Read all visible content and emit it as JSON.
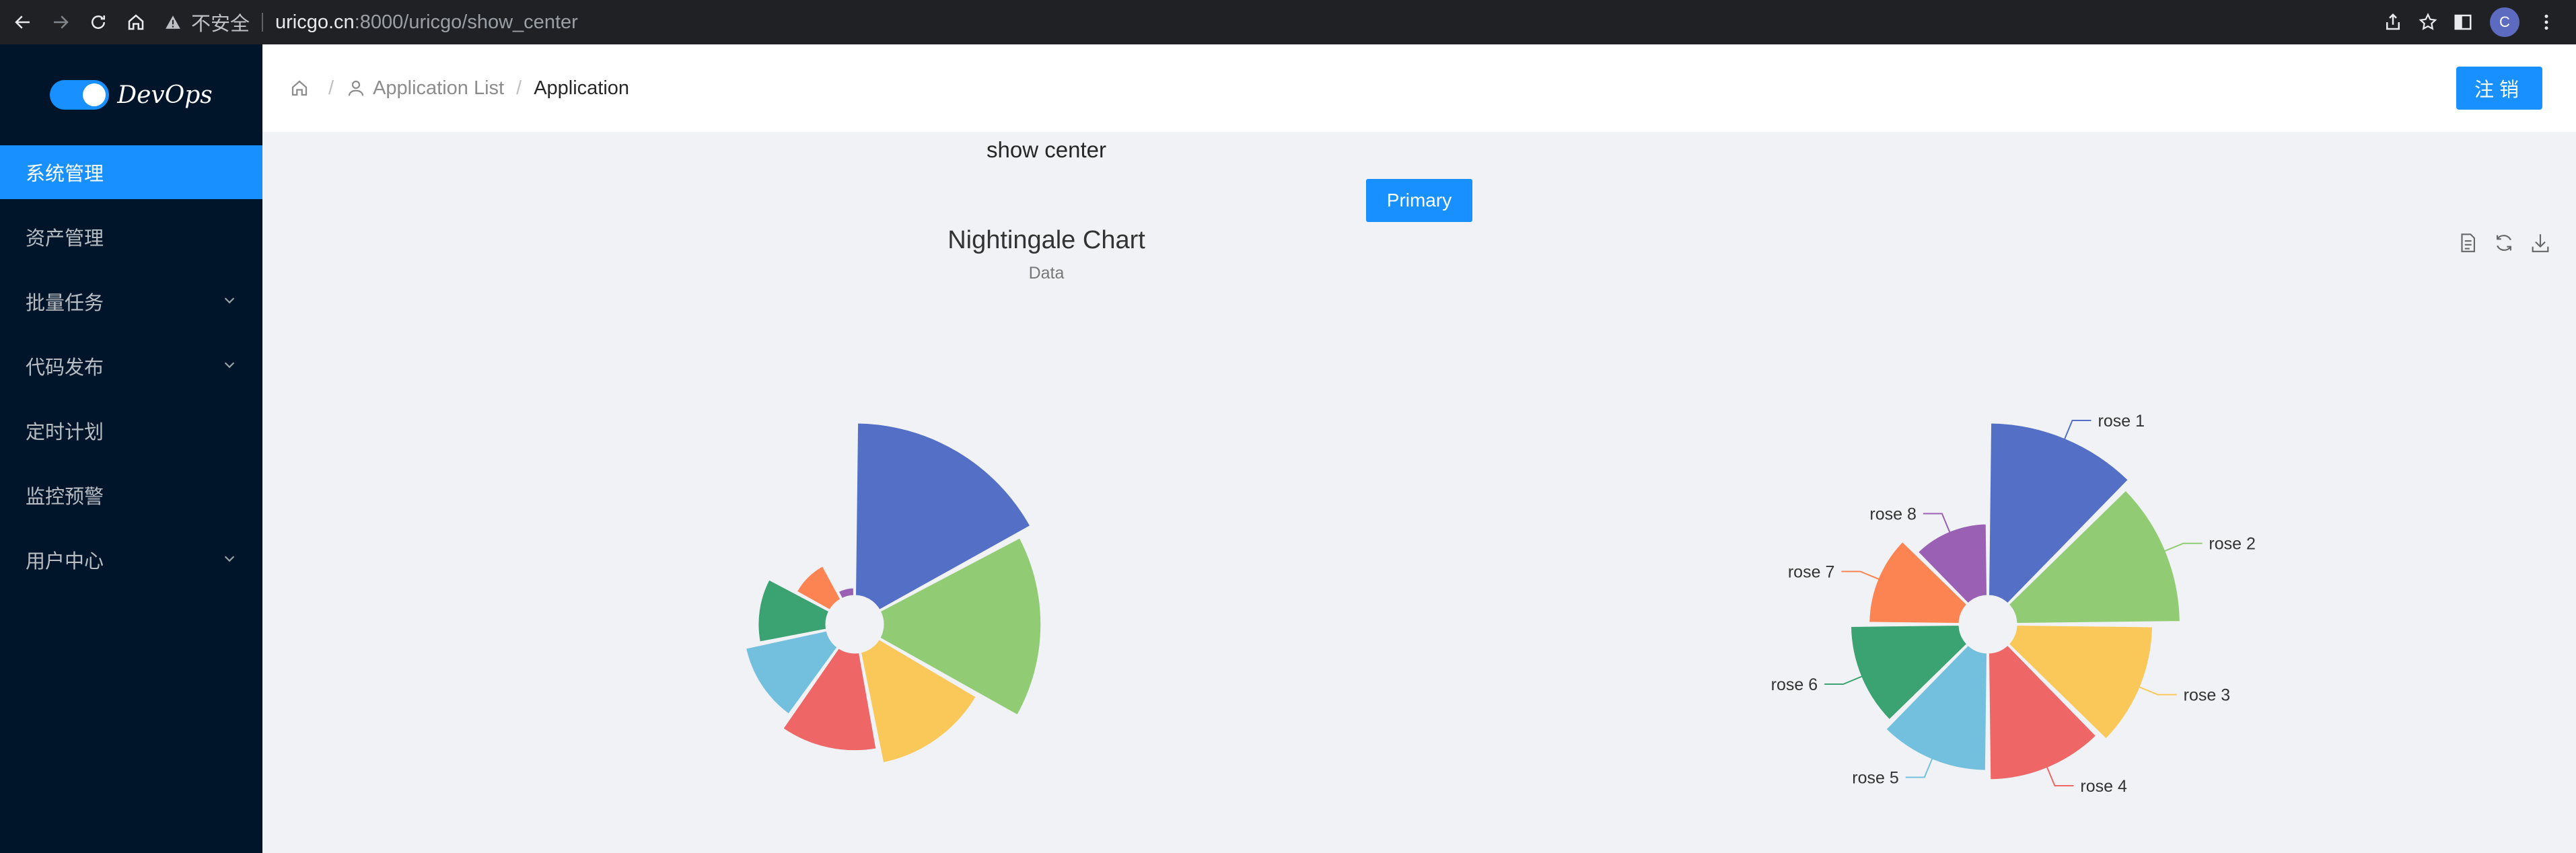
{
  "browser": {
    "security_label": "不安全",
    "url_host": "uricgo.cn",
    "url_rest": ":8000/uricgo/show_center",
    "profile_initial": "C"
  },
  "sidebar": {
    "logo_text": "DevOps",
    "items": [
      {
        "label": "系统管理",
        "active": true,
        "has_submenu": false
      },
      {
        "label": "资产管理",
        "active": false,
        "has_submenu": false
      },
      {
        "label": "批量任务",
        "active": false,
        "has_submenu": true
      },
      {
        "label": "代码发布",
        "active": false,
        "has_submenu": true
      },
      {
        "label": "定时计划",
        "active": false,
        "has_submenu": false
      },
      {
        "label": "监控预警",
        "active": false,
        "has_submenu": false
      },
      {
        "label": "用户中心",
        "active": false,
        "has_submenu": true
      }
    ]
  },
  "header": {
    "breadcrumb": [
      "Application List",
      "Application"
    ],
    "logout_label": "注销"
  },
  "main": {
    "title": "show center",
    "primary_label": "Primary"
  },
  "chart_data": {
    "type": "pie",
    "variant": "nightingale-rose",
    "title": "Nightingale Chart",
    "subtitle": "Data",
    "categories": [
      "rose 1",
      "rose 2",
      "rose 3",
      "rose 4",
      "rose 5",
      "rose 6",
      "rose 7",
      "rose 8"
    ],
    "colors": [
      "#5470c6",
      "#91cc75",
      "#fac858",
      "#ee6666",
      "#73c0de",
      "#3ba272",
      "#fc8452",
      "#9a60b4"
    ],
    "charts": [
      {
        "rose_type": "radius",
        "values": [
          40,
          38,
          32,
          30,
          28,
          26,
          22,
          18
        ],
        "labels_shown": false
      },
      {
        "rose_type": "area",
        "values": [
          40,
          38,
          32,
          30,
          28,
          26,
          22,
          18
        ],
        "labels_shown": true
      }
    ]
  }
}
